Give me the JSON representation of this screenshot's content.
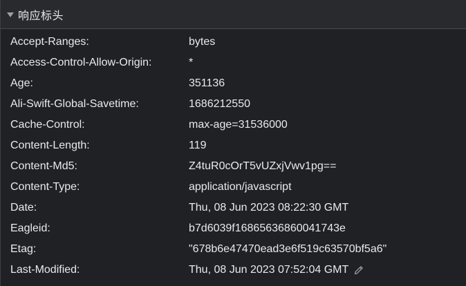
{
  "section": {
    "title": "响应标头"
  },
  "headers": [
    {
      "key": "Accept-Ranges:",
      "value": "bytes"
    },
    {
      "key": "Access-Control-Allow-Origin:",
      "value": "*"
    },
    {
      "key": "Age:",
      "value": "351136"
    },
    {
      "key": "Ali-Swift-Global-Savetime:",
      "value": "1686212550"
    },
    {
      "key": "Cache-Control:",
      "value": "max-age=31536000"
    },
    {
      "key": "Content-Length:",
      "value": "119"
    },
    {
      "key": "Content-Md5:",
      "value": "Z4tuR0cOrT5vUZxjVwv1pg=="
    },
    {
      "key": "Content-Type:",
      "value": "application/javascript"
    },
    {
      "key": "Date:",
      "value": "Thu, 08 Jun 2023 08:22:30 GMT"
    },
    {
      "key": "Eagleid:",
      "value": "b7d6039f16865636860041743e"
    },
    {
      "key": "Etag:",
      "value": "\"678b6e47470ead3e6f519c63570bf5a6\""
    },
    {
      "key": "Last-Modified:",
      "value": "Thu, 08 Jun 2023 07:52:04 GMT"
    }
  ],
  "icons": {
    "collapse": "triangle-down-icon",
    "edit": "pencil-icon"
  },
  "colors": {
    "background": "#202124",
    "header_background": "#292a2d",
    "text": "#e8eaed",
    "icon": "#9aa0a6"
  }
}
